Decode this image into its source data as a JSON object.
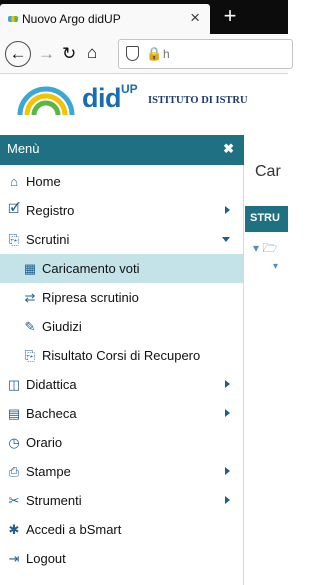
{
  "browser": {
    "tab_title": "Nuovo Argo didUP",
    "tab_close": "×",
    "new_tab": "+",
    "url": "h"
  },
  "app": {
    "logo_text": "did",
    "logo_sup": "UP",
    "school_name": "ISTITUTO DI ISTRU"
  },
  "menu": {
    "title": "Menù",
    "close": "✖",
    "items": [
      {
        "label": "Home",
        "icon": "home-icon"
      },
      {
        "label": "Registro",
        "icon": "calendar-check-icon",
        "arrow": "right"
      },
      {
        "label": "Scrutini",
        "icon": "document-export-icon",
        "arrow": "down"
      },
      {
        "label": "Caricamento voti",
        "icon": "grid-icon",
        "sub": true,
        "selected": true
      },
      {
        "label": "Ripresa scrutinio",
        "icon": "retweet-icon",
        "sub": true
      },
      {
        "label": "Giudizi",
        "icon": "edit-icon",
        "sub": true
      },
      {
        "label": "Risultato Corsi di Recupero",
        "icon": "document-export-icon",
        "sub": true
      },
      {
        "label": "Didattica",
        "icon": "columns-icon",
        "arrow": "right"
      },
      {
        "label": "Bacheca",
        "icon": "newspaper-icon",
        "arrow": "right"
      },
      {
        "label": "Orario",
        "icon": "clock-icon"
      },
      {
        "label": "Stampe",
        "icon": "print-icon",
        "arrow": "right"
      },
      {
        "label": "Strumenti",
        "icon": "tools-icon",
        "arrow": "right"
      },
      {
        "label": "Accedi a bSmart",
        "icon": "bsmart-icon"
      },
      {
        "label": "Logout",
        "icon": "logout-icon"
      }
    ]
  },
  "content": {
    "title": "Car",
    "toolbar": "STRU"
  },
  "colors": {
    "accent": "#1f7082",
    "selected": "#c4e3e8",
    "brand": "#1a6cb0"
  }
}
